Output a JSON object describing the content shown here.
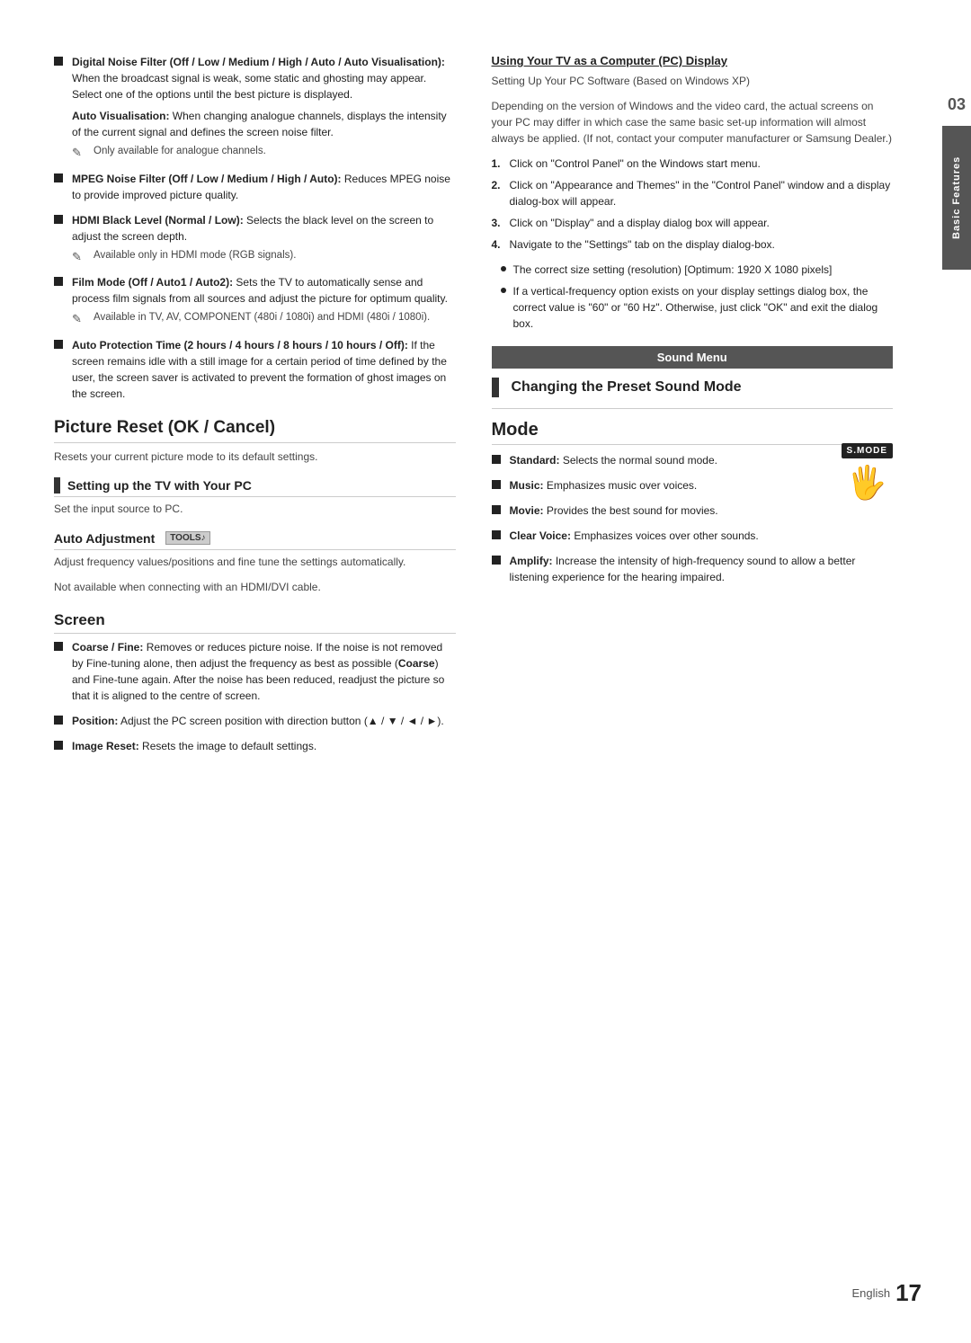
{
  "page": {
    "chapter": "03",
    "chapter_label": "Basic Features",
    "footer_text": "English",
    "footer_page": "17"
  },
  "left_column": {
    "bullets": [
      {
        "id": "digital-noise",
        "bold_intro": "Digital Noise Filter (Off / Low / Medium / High / Auto / Auto Visualisation):",
        "text": " When the broadcast signal is weak, some static and ghosting may appear. Select one of the options until the best picture is displayed.",
        "sub_note_bold": "Auto Visualisation:",
        "sub_note_text": " When changing analogue channels, displays the intensity of the current signal and defines the screen noise filter.",
        "pencil_note": "Only available for analogue channels."
      },
      {
        "id": "mpeg-noise",
        "bold_intro": "MPEG Noise Filter (Off / Low / Medium / High / Auto):",
        "text": " Reduces MPEG noise to provide improved picture quality."
      },
      {
        "id": "hdmi-black",
        "bold_intro": "HDMI Black Level (Normal / Low):",
        "text": " Selects the black level on the screen to adjust the screen depth.",
        "pencil_note": "Available only in HDMI mode (RGB signals)."
      },
      {
        "id": "film-mode",
        "bold_intro": "Film Mode (Off / Auto1 / Auto2):",
        "text": " Sets the TV to automatically sense and process film signals from all sources and adjust the picture for optimum quality.",
        "pencil_note": "Available in TV, AV, COMPONENT (480i / 1080i) and HDMI (480i / 1080i)."
      },
      {
        "id": "auto-protection",
        "bold_intro": "Auto Protection Time (2 hours / 4 hours / 8 hours / 10 hours / Off):",
        "text": " If the screen remains idle with a still image for a certain period of time defined by the user, the screen saver is activated to prevent the formation of ghost images on the screen."
      }
    ],
    "picture_reset": {
      "heading": "Picture Reset (OK / Cancel)",
      "text": "Resets your current picture mode to its default settings."
    },
    "setting_up": {
      "heading": "Setting up the TV with Your PC",
      "text": "Set the input source to PC."
    },
    "auto_adjustment": {
      "heading": "Auto Adjustment",
      "tools_badge": "TOOLS",
      "music_note": "♪",
      "text1": "Adjust frequency values/positions and fine tune the settings automatically.",
      "text2": "Not available when connecting with an HDMI/DVI cable."
    },
    "screen": {
      "heading": "Screen",
      "bullets": [
        {
          "id": "coarse-fine",
          "bold_intro": "Coarse / Fine:",
          "text": " Removes or reduces picture noise. If the noise is not removed by Fine-tuning alone, then adjust the frequency as best as possible (",
          "bold_mid": "Coarse",
          "text2": ") and Fine-tune again. After the noise has been reduced, readjust the picture so that it is aligned to the centre of screen."
        },
        {
          "id": "position",
          "bold_intro": "Position:",
          "text": " Adjust the PC screen position with direction button (▲ / ▼ / ◄ / ►)."
        },
        {
          "id": "image-reset",
          "bold_intro": "Image Reset:",
          "text": " Resets the image to default settings."
        }
      ]
    }
  },
  "right_column": {
    "using_tv": {
      "heading": "Using Your TV as a Computer (PC) Display",
      "intro": "Setting Up Your PC Software (Based on Windows XP)",
      "desc": "Depending on the version of Windows and the video card, the actual screens on your PC may differ in which case the same basic set-up information will almost always be applied. (If not, contact your computer manufacturer or Samsung Dealer.)",
      "steps": [
        "Click on \"Control Panel\" on the Windows start menu.",
        "Click on \"Appearance and Themes\" in the \"Control Panel\" window and a display dialog-box will appear.",
        "Click on \"Display\" and a display dialog box will appear.",
        "Navigate to the \"Settings\" tab on the display dialog-box."
      ],
      "circle_items": [
        "The correct size setting (resolution) [Optimum: 1920 X 1080 pixels]",
        "If a vertical-frequency option exists on your display settings dialog box, the correct value is \"60\" or \"60 Hz\". Otherwise, just click \"OK\" and exit the dialog box."
      ]
    },
    "sound_menu": {
      "banner": "Sound Menu"
    },
    "changing_preset": {
      "heading": "Changing the Preset Sound Mode"
    },
    "mode": {
      "heading": "Mode",
      "smode_label": "S.MODE",
      "smode_hand": "☞",
      "bullets": [
        {
          "id": "standard",
          "bold_intro": "Standard:",
          "text": " Selects the normal sound mode."
        },
        {
          "id": "music",
          "bold_intro": "Music:",
          "text": " Emphasizes music over voices."
        },
        {
          "id": "movie",
          "bold_intro": "Movie:",
          "text": " Provides the best sound for movies."
        },
        {
          "id": "clear-voice",
          "bold_intro": "Clear Voice:",
          "text": " Emphasizes voices over other sounds."
        },
        {
          "id": "amplify",
          "bold_intro": "Amplify:",
          "text": " Increase the intensity of high-frequency sound to allow a better listening experience for the hearing impaired."
        }
      ]
    }
  }
}
